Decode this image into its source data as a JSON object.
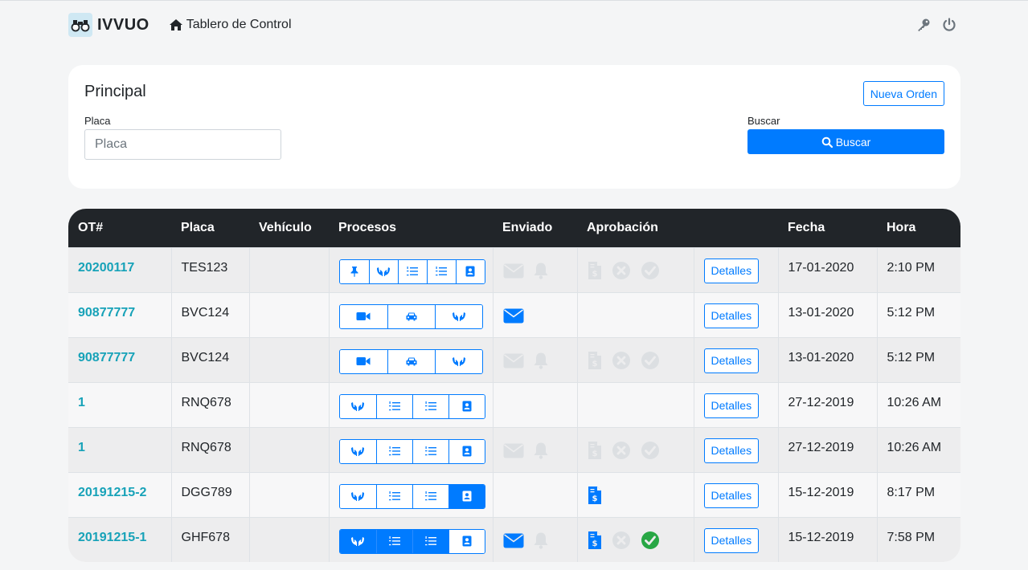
{
  "nav": {
    "brand": "IVVUO",
    "home_label": "Tablero de Control"
  },
  "card": {
    "title": "Principal",
    "new_order_label": "Nueva Orden",
    "placa_label": "Placa",
    "placa_placeholder": "Placa",
    "search_label": "Buscar",
    "search_button": "Buscar"
  },
  "table": {
    "headers": [
      "OT#",
      "Placa",
      "Vehículo",
      "Procesos",
      "Enviado",
      "Aprobación",
      "",
      "Fecha",
      "Hora"
    ],
    "details_label": "Detalles",
    "rows": [
      {
        "ot": "20200117",
        "placa": "TES123",
        "vehiculo": "",
        "fecha": "17-01-2020",
        "hora": "2:10 PM",
        "procesos": [
          {
            "icon": "pin-icon",
            "active": false
          },
          {
            "icon": "hands-icon",
            "active": false
          },
          {
            "icon": "list-ol-icon",
            "active": false
          },
          {
            "icon": "list-ol-icon",
            "active": false
          },
          {
            "icon": "contact-card-icon",
            "active": false
          }
        ],
        "enviado": [
          {
            "icon": "envelope-icon",
            "state": "muted"
          },
          {
            "icon": "bell-icon",
            "state": "muted"
          }
        ],
        "aprobacion": [
          {
            "icon": "invoice-icon",
            "state": "muted"
          },
          {
            "icon": "x-circle-icon",
            "state": "muted"
          },
          {
            "icon": "check-circle-icon",
            "state": "muted"
          }
        ]
      },
      {
        "ot": "90877777",
        "placa": "BVC124",
        "vehiculo": "",
        "fecha": "13-01-2020",
        "hora": "5:12 PM",
        "procesos": [
          {
            "icon": "video-icon",
            "active": false
          },
          {
            "icon": "car-icon",
            "active": false
          },
          {
            "icon": "hands-icon",
            "active": false
          }
        ],
        "enviado": [
          {
            "icon": "envelope-icon",
            "state": "blue"
          }
        ],
        "aprobacion": []
      },
      {
        "ot": "90877777",
        "placa": "BVC124",
        "vehiculo": "",
        "fecha": "13-01-2020",
        "hora": "5:12 PM",
        "procesos": [
          {
            "icon": "video-icon",
            "active": false
          },
          {
            "icon": "car-icon",
            "active": false
          },
          {
            "icon": "hands-icon",
            "active": false
          }
        ],
        "enviado": [
          {
            "icon": "envelope-icon",
            "state": "muted"
          },
          {
            "icon": "bell-icon",
            "state": "muted"
          }
        ],
        "aprobacion": [
          {
            "icon": "invoice-icon",
            "state": "muted"
          },
          {
            "icon": "x-circle-icon",
            "state": "muted"
          },
          {
            "icon": "check-circle-icon",
            "state": "muted"
          }
        ]
      },
      {
        "ot": "1",
        "placa": "RNQ678",
        "vehiculo": "",
        "fecha": "27-12-2019",
        "hora": "10:26 AM",
        "procesos": [
          {
            "icon": "hands-icon",
            "active": false
          },
          {
            "icon": "list-ol-icon",
            "active": false
          },
          {
            "icon": "list-ol-icon",
            "active": false
          },
          {
            "icon": "contact-card-icon",
            "active": false
          }
        ],
        "enviado": [],
        "aprobacion": []
      },
      {
        "ot": "1",
        "placa": "RNQ678",
        "vehiculo": "",
        "fecha": "27-12-2019",
        "hora": "10:26 AM",
        "procesos": [
          {
            "icon": "hands-icon",
            "active": false
          },
          {
            "icon": "list-ol-icon",
            "active": false
          },
          {
            "icon": "list-ol-icon",
            "active": false
          },
          {
            "icon": "contact-card-icon",
            "active": false
          }
        ],
        "enviado": [
          {
            "icon": "envelope-icon",
            "state": "muted"
          },
          {
            "icon": "bell-icon",
            "state": "muted"
          }
        ],
        "aprobacion": [
          {
            "icon": "invoice-icon",
            "state": "muted"
          },
          {
            "icon": "x-circle-icon",
            "state": "muted"
          },
          {
            "icon": "check-circle-icon",
            "state": "muted"
          }
        ]
      },
      {
        "ot": "20191215-2",
        "placa": "DGG789",
        "vehiculo": "",
        "fecha": "15-12-2019",
        "hora": "8:17 PM",
        "procesos": [
          {
            "icon": "hands-icon",
            "active": false
          },
          {
            "icon": "list-ol-icon",
            "active": false
          },
          {
            "icon": "list-ol-icon",
            "active": false
          },
          {
            "icon": "contact-card-icon",
            "active": true
          }
        ],
        "enviado": [],
        "aprobacion": [
          {
            "icon": "invoice-icon",
            "state": "blue"
          }
        ]
      },
      {
        "ot": "20191215-1",
        "placa": "GHF678",
        "vehiculo": "",
        "fecha": "15-12-2019",
        "hora": "7:58 PM",
        "procesos": [
          {
            "icon": "hands-icon",
            "active": true
          },
          {
            "icon": "list-ol-icon",
            "active": true
          },
          {
            "icon": "list-ol-icon",
            "active": true
          },
          {
            "icon": "contact-card-icon",
            "active": false
          }
        ],
        "enviado": [
          {
            "icon": "envelope-icon",
            "state": "blue"
          },
          {
            "icon": "bell-icon",
            "state": "muted"
          }
        ],
        "aprobacion": [
          {
            "icon": "invoice-icon",
            "state": "blue"
          },
          {
            "icon": "x-circle-icon",
            "state": "muted"
          },
          {
            "icon": "check-circle-icon",
            "state": "green"
          }
        ]
      }
    ]
  },
  "colors": {
    "primary": "#007bff",
    "teal": "#17a2b8",
    "success": "#28a745",
    "muted": "#dcdfe2",
    "dark": "#212529"
  }
}
